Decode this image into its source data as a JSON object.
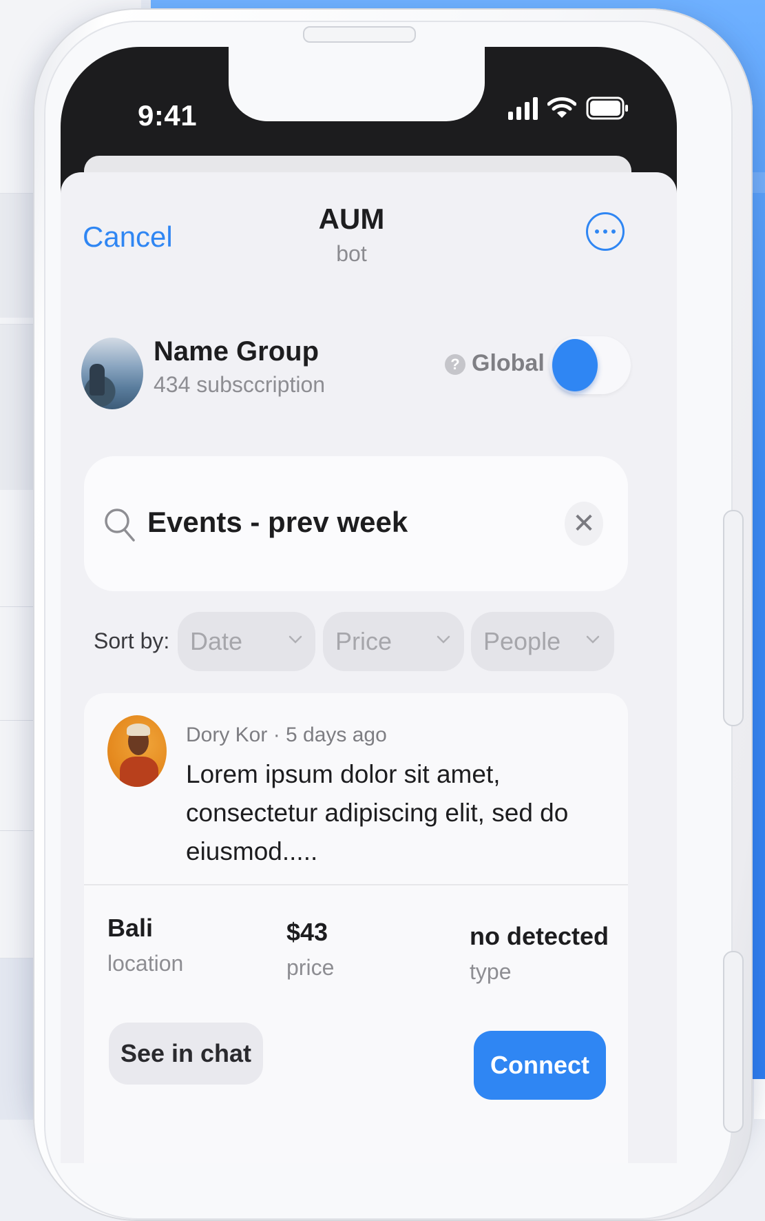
{
  "status_bar": {
    "time": "9:41",
    "icons": [
      "signal-icon",
      "wifi-icon",
      "battery-icon"
    ]
  },
  "nav": {
    "cancel_label": "Cancel",
    "title": "AUM",
    "subtitle": "bot",
    "more_icon": "ellipsis-circle-icon"
  },
  "group": {
    "name": "Name Group",
    "subscriptions": "434 subsccription",
    "help_icon_glyph": "?",
    "global_label": "Global",
    "global_enabled": true
  },
  "search": {
    "query": "Events - prev week",
    "clear_glyph": "✕"
  },
  "sort": {
    "label": "Sort by:",
    "options": [
      {
        "label": "Date"
      },
      {
        "label": "Price"
      },
      {
        "label": "People"
      }
    ]
  },
  "post": {
    "meta": "Dory Kor · 5 days ago",
    "text": "Lorem ipsum dolor sit amet, consectetur adipiscing elit, sed do eiusmod.....",
    "stats": [
      {
        "value": "Bali",
        "label": "location"
      },
      {
        "value": "$43",
        "label": "price"
      },
      {
        "value": "no detected",
        "label": "type"
      }
    ],
    "see_in_chat_label": "See in chat",
    "connect_label": "Connect"
  },
  "colors": {
    "accent": "#2f86f3",
    "background_blue": "#3d8ef8",
    "text_primary": "#1d1d1f",
    "text_secondary": "#8d8d92"
  }
}
